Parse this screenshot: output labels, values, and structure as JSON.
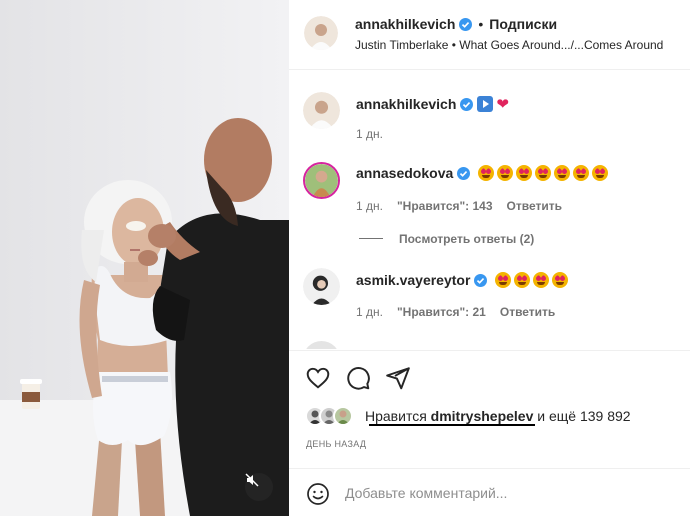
{
  "header": {
    "username": "annakhilkevich",
    "separator": "•",
    "follow_label": "Подписки",
    "audio": "Justin Timberlake • What Goes Around.../...Comes Around"
  },
  "comments": [
    {
      "username": "annakhilkevich",
      "time": "1 дн."
    },
    {
      "username": "annasedokova",
      "time": "1 дн.",
      "likes": "\"Нравится\": 143",
      "reply": "Ответить",
      "emoji_count": 7,
      "view_replies": "Посмотреть ответы (2)"
    },
    {
      "username": "asmik.vayereytor",
      "time": "1 дн.",
      "likes": "\"Нравится\": 21",
      "reply": "Ответить",
      "emoji_count": 4
    }
  ],
  "likes": {
    "prefix": "Нравится",
    "user": "dmitryshepelev",
    "suffix": "и ещё 139 892"
  },
  "date": "ДЕНЬ НАЗАД",
  "composer": {
    "placeholder": "Добавьте комментарий..."
  },
  "colors": {
    "verified": "#3897f0",
    "text": "#262626",
    "muted": "#737373"
  },
  "icons": [
    "verified-icon",
    "heart-icon",
    "comment-icon",
    "share-icon",
    "smile-icon",
    "mute-icon"
  ]
}
